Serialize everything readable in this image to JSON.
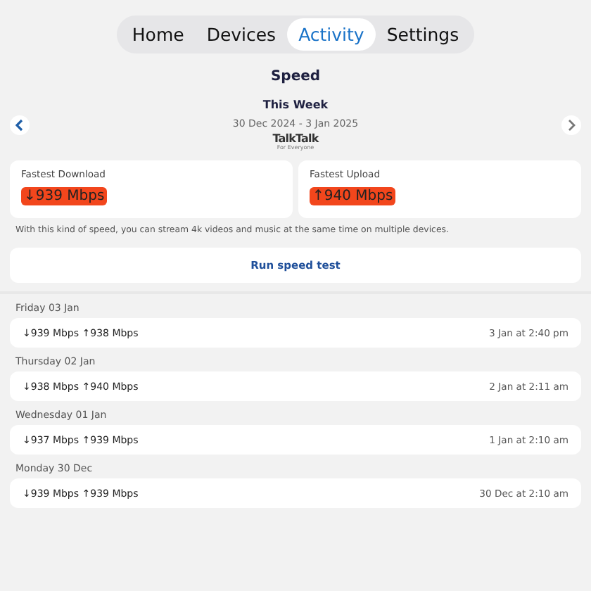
{
  "tabs": [
    {
      "label": "Home",
      "selected": false
    },
    {
      "label": "Devices",
      "selected": false
    },
    {
      "label": "Activity",
      "selected": true
    },
    {
      "label": "Settings",
      "selected": false
    }
  ],
  "title": "Speed",
  "period": {
    "label": "This Week",
    "range": "30 Dec 2024 - 3 Jan 2025"
  },
  "logo": {
    "name": "TalkTalk",
    "tagline": "For Everyone"
  },
  "summary": [
    {
      "label": "Fastest Download",
      "value": "↓939 Mbps",
      "highlighted": true
    },
    {
      "label": "Fastest Upload",
      "value": "↑940 Mbps",
      "highlighted": true
    }
  ],
  "note": "With this kind of speed, you can stream 4k videos and music at the same time on multiple devices.",
  "run_button": "Run speed test",
  "history": [
    {
      "day": "Friday 03 Jan",
      "speeds": "↓939 Mbps ↑938 Mbps",
      "time": "3 Jan at 2:40 pm"
    },
    {
      "day": "Thursday 02 Jan",
      "speeds": "↓938 Mbps ↑940 Mbps",
      "time": "2 Jan at 2:11 am"
    },
    {
      "day": "Wednesday 01 Jan",
      "speeds": "↓937 Mbps ↑939 Mbps",
      "time": "1 Jan at 2:10 am"
    },
    {
      "day": "Monday 30 Dec",
      "speeds": "↓939 Mbps ↑939 Mbps",
      "time": "30 Dec at 2:10 am"
    }
  ]
}
